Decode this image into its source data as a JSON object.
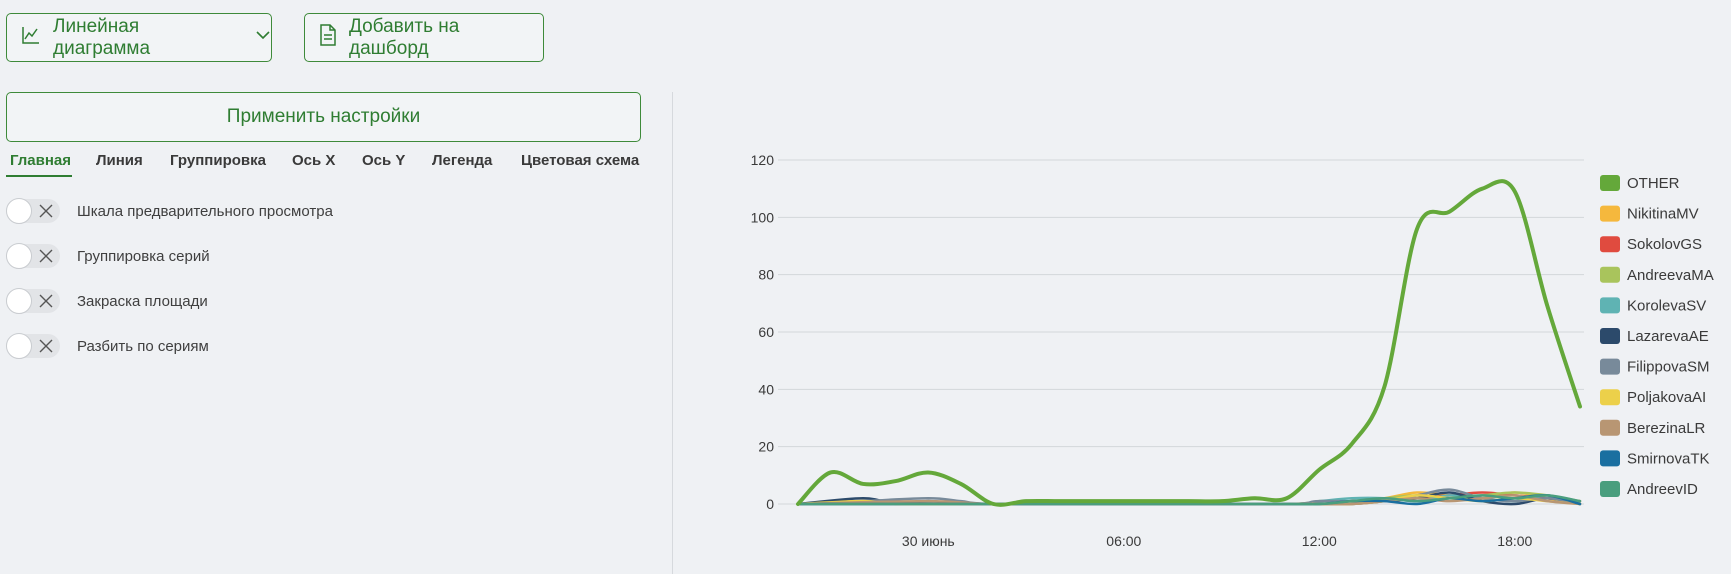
{
  "toolbar": {
    "chart_type_label": "Линейная диаграмма",
    "add_dashboard_label": "Добавить на дашборд",
    "apply_label": "Применить настройки"
  },
  "tabs": [
    {
      "label": "Главная",
      "active": true
    },
    {
      "label": "Линия"
    },
    {
      "label": "Группировка"
    },
    {
      "label": "Ось X"
    },
    {
      "label": "Ось Y"
    },
    {
      "label": "Легенда"
    },
    {
      "label": "Цветовая схема"
    }
  ],
  "toggles": [
    {
      "label": "Шкала предварительного просмотра",
      "on": false
    },
    {
      "label": "Группировка серий",
      "on": false
    },
    {
      "label": "Закраска площади",
      "on": false
    },
    {
      "label": "Разбить по сериям",
      "on": false
    }
  ],
  "colors": {
    "accent": "#2f7d32"
  },
  "chart_data": {
    "type": "line",
    "title": "",
    "xlabel": "",
    "ylabel": "",
    "ylim": [
      0,
      120
    ],
    "yticks": [
      0,
      20,
      40,
      60,
      80,
      100,
      120
    ],
    "xlim": [
      0,
      48
    ],
    "xticks": [
      {
        "x": 8,
        "label": "30 июнь"
      },
      {
        "x": 20,
        "label": "06:00"
      },
      {
        "x": 32,
        "label": "12:00"
      },
      {
        "x": 44,
        "label": "18:00"
      }
    ],
    "grid": true,
    "legend_position": "right",
    "series": [
      {
        "name": "OTHER",
        "color": "#64a83a",
        "values": [
          [
            0,
            0
          ],
          [
            2,
            11
          ],
          [
            4,
            7
          ],
          [
            6,
            8
          ],
          [
            8,
            11
          ],
          [
            10,
            7
          ],
          [
            12,
            0
          ],
          [
            14,
            1
          ],
          [
            16,
            1
          ],
          [
            18,
            1
          ],
          [
            20,
            1
          ],
          [
            22,
            1
          ],
          [
            24,
            1
          ],
          [
            26,
            1
          ],
          [
            28,
            2
          ],
          [
            30,
            2
          ],
          [
            32,
            12
          ],
          [
            34,
            21
          ],
          [
            36,
            41
          ],
          [
            38,
            96
          ],
          [
            40,
            102
          ],
          [
            42,
            110
          ],
          [
            44,
            109
          ],
          [
            46,
            69
          ],
          [
            48,
            34
          ]
        ]
      },
      {
        "name": "NikitinaMV",
        "color": "#f5b83d",
        "values": [
          [
            0,
            0
          ],
          [
            4,
            1
          ],
          [
            8,
            0
          ],
          [
            12,
            0
          ],
          [
            20,
            0
          ],
          [
            28,
            0
          ],
          [
            30,
            0
          ],
          [
            32,
            0
          ],
          [
            34,
            1
          ],
          [
            36,
            2
          ],
          [
            38,
            4
          ],
          [
            40,
            3
          ],
          [
            42,
            2
          ],
          [
            44,
            4
          ],
          [
            46,
            2
          ],
          [
            48,
            0
          ]
        ]
      },
      {
        "name": "SokolovGS",
        "color": "#e04b3f",
        "values": [
          [
            0,
            0
          ],
          [
            12,
            0
          ],
          [
            20,
            0
          ],
          [
            30,
            0
          ],
          [
            32,
            0
          ],
          [
            34,
            1
          ],
          [
            36,
            1
          ],
          [
            38,
            2
          ],
          [
            40,
            3
          ],
          [
            42,
            4
          ],
          [
            44,
            3
          ],
          [
            46,
            2
          ],
          [
            48,
            1
          ]
        ]
      },
      {
        "name": "AndreevaMA",
        "color": "#a9c45c",
        "values": [
          [
            0,
            0
          ],
          [
            12,
            0
          ],
          [
            20,
            0
          ],
          [
            30,
            0
          ],
          [
            32,
            1
          ],
          [
            34,
            1
          ],
          [
            36,
            2
          ],
          [
            38,
            3
          ],
          [
            40,
            2
          ],
          [
            42,
            3
          ],
          [
            44,
            4
          ],
          [
            46,
            3
          ],
          [
            48,
            1
          ]
        ]
      },
      {
        "name": "KorolevaSV",
        "color": "#5fb3b3",
        "values": [
          [
            0,
            0
          ],
          [
            12,
            0
          ],
          [
            20,
            0
          ],
          [
            30,
            0
          ],
          [
            32,
            1
          ],
          [
            34,
            2
          ],
          [
            36,
            2
          ],
          [
            38,
            1
          ],
          [
            40,
            3
          ],
          [
            42,
            2
          ],
          [
            44,
            1
          ],
          [
            46,
            3
          ],
          [
            48,
            0
          ]
        ]
      },
      {
        "name": "LazarevaAE",
        "color": "#2c4a6b",
        "values": [
          [
            0,
            0
          ],
          [
            4,
            2
          ],
          [
            6,
            0
          ],
          [
            8,
            1
          ],
          [
            10,
            0
          ],
          [
            12,
            0
          ],
          [
            20,
            0
          ],
          [
            30,
            0
          ],
          [
            34,
            0
          ],
          [
            36,
            1
          ],
          [
            38,
            2
          ],
          [
            40,
            4
          ],
          [
            42,
            1
          ],
          [
            44,
            0
          ],
          [
            46,
            2
          ],
          [
            48,
            0
          ]
        ]
      },
      {
        "name": "FilippovaSM",
        "color": "#788a9a",
        "values": [
          [
            0,
            0
          ],
          [
            4,
            1
          ],
          [
            8,
            2
          ],
          [
            10,
            1
          ],
          [
            12,
            0
          ],
          [
            20,
            0
          ],
          [
            30,
            0
          ],
          [
            32,
            1
          ],
          [
            36,
            1
          ],
          [
            38,
            3
          ],
          [
            40,
            5
          ],
          [
            42,
            2
          ],
          [
            44,
            1
          ],
          [
            46,
            2
          ],
          [
            48,
            0
          ]
        ]
      },
      {
        "name": "PoljakovaAI",
        "color": "#ecd04a",
        "values": [
          [
            0,
            0
          ],
          [
            4,
            1
          ],
          [
            6,
            0
          ],
          [
            12,
            0
          ],
          [
            20,
            0
          ],
          [
            30,
            0
          ],
          [
            32,
            0
          ],
          [
            34,
            0
          ],
          [
            36,
            1
          ],
          [
            38,
            3
          ],
          [
            40,
            2
          ],
          [
            42,
            1
          ],
          [
            44,
            2
          ],
          [
            46,
            1
          ],
          [
            48,
            0
          ]
        ]
      },
      {
        "name": "BerezinaLR",
        "color": "#b89673",
        "values": [
          [
            0,
            0
          ],
          [
            8,
            1
          ],
          [
            12,
            0
          ],
          [
            20,
            0
          ],
          [
            30,
            0
          ],
          [
            34,
            0
          ],
          [
            36,
            1
          ],
          [
            38,
            2
          ],
          [
            40,
            1
          ],
          [
            42,
            2
          ],
          [
            44,
            3
          ],
          [
            46,
            1
          ],
          [
            48,
            0
          ]
        ]
      },
      {
        "name": "SmirnovaTK",
        "color": "#1a6fa0",
        "values": [
          [
            0,
            0
          ],
          [
            12,
            0
          ],
          [
            20,
            0
          ],
          [
            30,
            0
          ],
          [
            32,
            0
          ],
          [
            34,
            1
          ],
          [
            36,
            1
          ],
          [
            38,
            0
          ],
          [
            40,
            2
          ],
          [
            42,
            1
          ],
          [
            44,
            2
          ],
          [
            46,
            3
          ],
          [
            48,
            0
          ]
        ]
      },
      {
        "name": "AndreevID",
        "color": "#4a9e7e",
        "values": [
          [
            0,
            0
          ],
          [
            12,
            0
          ],
          [
            20,
            0
          ],
          [
            30,
            0
          ],
          [
            32,
            0
          ],
          [
            34,
            1
          ],
          [
            36,
            2
          ],
          [
            38,
            1
          ],
          [
            40,
            2
          ],
          [
            42,
            3
          ],
          [
            44,
            2
          ],
          [
            46,
            3
          ],
          [
            48,
            1
          ]
        ]
      }
    ]
  }
}
